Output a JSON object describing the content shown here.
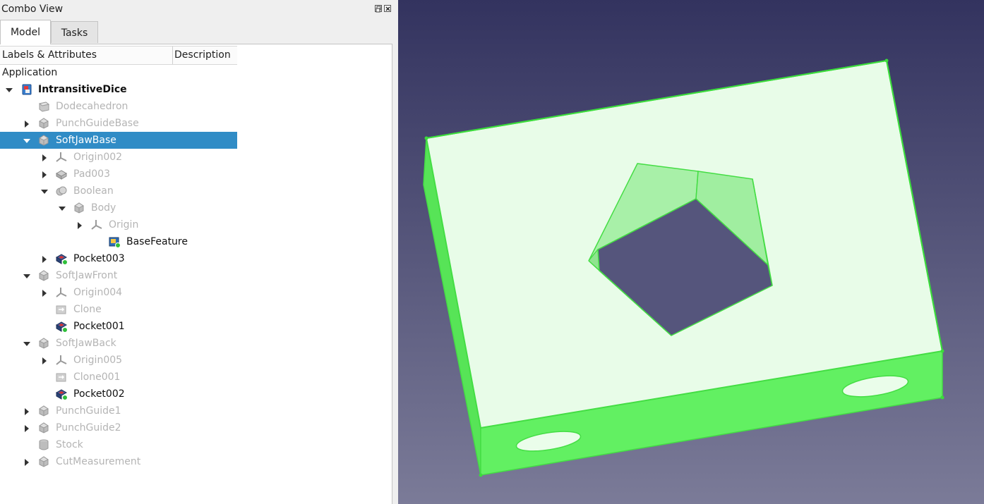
{
  "panel": {
    "title": "Combo View",
    "tabs": [
      {
        "label": "Model",
        "active": true
      },
      {
        "label": "Tasks",
        "active": false
      }
    ],
    "columns": [
      "Labels & Attributes",
      "Description"
    ],
    "root_label": "Application"
  },
  "tree": [
    {
      "label": "IntransitiveDice",
      "style": "bold",
      "icon": "document-icon",
      "expand": "expanded"
    },
    {
      "label": "Dodecahedron",
      "style": "dim",
      "icon": "part-icon",
      "expand": "none"
    },
    {
      "label": "PunchGuideBase",
      "style": "dim",
      "icon": "body-icon",
      "expand": "collapsed"
    },
    {
      "label": "SoftJawBase",
      "style": "selected",
      "icon": "body-icon",
      "expand": "expanded"
    },
    {
      "label": "Origin002",
      "style": "dim",
      "icon": "origin-icon",
      "expand": "collapsed"
    },
    {
      "label": "Pad003",
      "style": "dim",
      "icon": "pad-icon",
      "expand": "collapsed"
    },
    {
      "label": "Boolean",
      "style": "dim",
      "icon": "boolean-icon",
      "expand": "expanded"
    },
    {
      "label": "Body",
      "style": "dim",
      "icon": "body-icon",
      "expand": "expanded"
    },
    {
      "label": "Origin",
      "style": "dim",
      "icon": "origin-icon",
      "expand": "collapsed"
    },
    {
      "label": "BaseFeature",
      "style": "normal",
      "icon": "base-feature-icon",
      "expand": "none"
    },
    {
      "label": "Pocket003",
      "style": "normal",
      "icon": "pocket-icon",
      "expand": "collapsed"
    },
    {
      "label": "SoftJawFront",
      "style": "dim",
      "icon": "body-icon",
      "expand": "expanded"
    },
    {
      "label": "Origin004",
      "style": "dim",
      "icon": "origin-icon",
      "expand": "collapsed"
    },
    {
      "label": "Clone",
      "style": "dim",
      "icon": "clone-icon",
      "expand": "none"
    },
    {
      "label": "Pocket001",
      "style": "normal",
      "icon": "pocket-icon",
      "expand": "none"
    },
    {
      "label": "SoftJawBack",
      "style": "dim",
      "icon": "body-icon",
      "expand": "expanded"
    },
    {
      "label": "Origin005",
      "style": "dim",
      "icon": "origin-icon",
      "expand": "collapsed"
    },
    {
      "label": "Clone001",
      "style": "dim",
      "icon": "clone-icon",
      "expand": "none"
    },
    {
      "label": "Pocket002",
      "style": "normal",
      "icon": "pocket-icon",
      "expand": "none"
    },
    {
      "label": "PunchGuide1",
      "style": "dim",
      "icon": "body-icon",
      "expand": "collapsed"
    },
    {
      "label": "PunchGuide2",
      "style": "dim",
      "icon": "body-icon",
      "expand": "collapsed"
    },
    {
      "label": "Stock",
      "style": "dim",
      "icon": "stock-icon",
      "expand": "none"
    },
    {
      "label": "CutMeasurement",
      "style": "dim",
      "icon": "body-icon",
      "expand": "collapsed"
    }
  ],
  "colors": {
    "selection": "#308cc6",
    "viewport_top": "#33335f",
    "viewport_bottom": "#7b7b98",
    "part_highlight": "#66f266",
    "part_top_face": "#e8fce8"
  }
}
